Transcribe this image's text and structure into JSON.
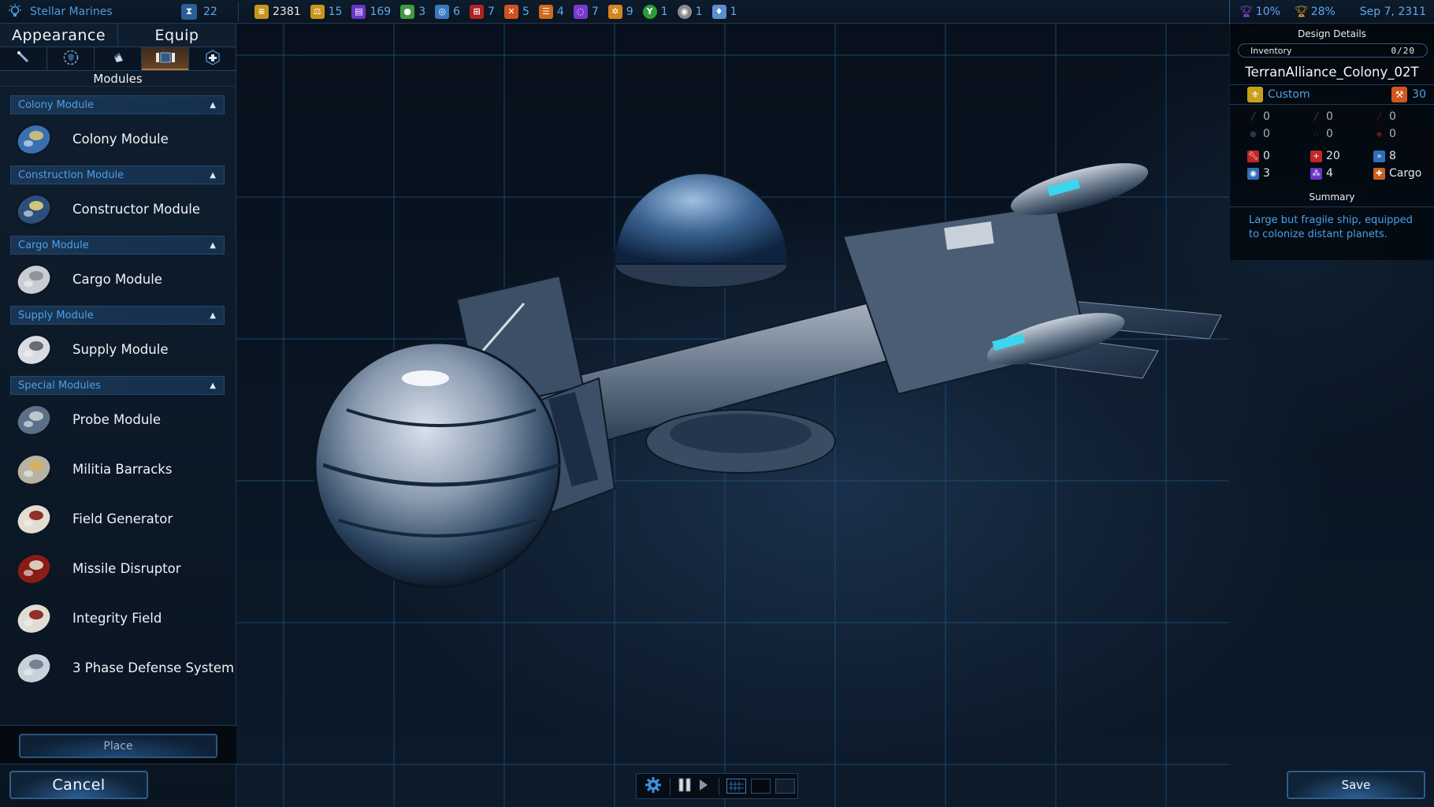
{
  "topbar": {
    "faction_name": "Stellar Marines",
    "turn_count": "22",
    "resources": [
      {
        "name": "credits",
        "icon": "credits-icon",
        "value": "2381",
        "color": "#c8951c"
      },
      {
        "name": "influence",
        "icon": "scales-icon",
        "value": "15",
        "color": "#c8951c"
      },
      {
        "name": "research",
        "icon": "research-icon",
        "value": "169",
        "color": "#6a35c6"
      },
      {
        "name": "food",
        "icon": "apple-icon",
        "value": "3",
        "color": "#3f9a3f"
      },
      {
        "name": "tech-resource",
        "icon": "ring-icon",
        "value": "6",
        "color": "#3a78c0"
      },
      {
        "name": "strategic-resource-1",
        "icon": "grid-icon",
        "value": "7",
        "color": "#b02222"
      },
      {
        "name": "strategic-resource-2",
        "icon": "cross-icon",
        "value": "5",
        "color": "#d0521e"
      },
      {
        "name": "strategic-resource-3",
        "icon": "stripes-icon",
        "value": "4",
        "color": "#d06a18"
      },
      {
        "name": "strategic-resource-4",
        "icon": "swirl-icon",
        "value": "7",
        "color": "#7a3ad0"
      },
      {
        "name": "strategic-resource-5",
        "icon": "gear-flower-icon",
        "value": "9",
        "color": "#d4861e"
      },
      {
        "name": "strategic-resource-6",
        "icon": "tree-icon",
        "value": "1",
        "color": "#2e9a3c"
      },
      {
        "name": "strategic-resource-7",
        "icon": "disc-icon",
        "value": "1",
        "color": "#8a8a8a"
      },
      {
        "name": "strategic-resource-8",
        "icon": "crystal-icon",
        "value": "1",
        "color": "#5d8ed0"
      }
    ],
    "score_purple": "10%",
    "score_gold": "28%",
    "date": "Sep 7, 2311"
  },
  "left_panel": {
    "tabs": [
      "Appearance",
      "Equip"
    ],
    "icon_tabs": [
      {
        "icon": "weapon-icon",
        "active": false
      },
      {
        "icon": "shield-icon",
        "active": false
      },
      {
        "icon": "armor-icon",
        "active": false
      },
      {
        "icon": "module-icon",
        "active": true
      },
      {
        "icon": "support-icon",
        "active": false
      }
    ],
    "category_title": "Modules",
    "sections": [
      {
        "title": "Colony Module",
        "items": [
          "Colony Module"
        ]
      },
      {
        "title": "Construction Module",
        "items": [
          "Constructor Module"
        ]
      },
      {
        "title": "Cargo Module",
        "items": [
          "Cargo Module"
        ]
      },
      {
        "title": "Supply Module",
        "items": [
          "Supply Module"
        ]
      },
      {
        "title": "Special Modules",
        "items": [
          "Probe Module",
          "Militia Barracks",
          "Field Generator",
          "Missile Disruptor",
          "Integrity Field",
          "3 Phase Defense System"
        ]
      }
    ],
    "place_label": "Place",
    "cancel_label": "Cancel"
  },
  "right_panel": {
    "title": "Design Details",
    "inventory_label": "Inventory",
    "inventory_count": "0/20",
    "design_name": "TerranAlliance_Colony_02T",
    "design_class": "Custom",
    "build_cost": "30",
    "stats": [
      {
        "icon": "beam-weapon-icon",
        "value": "0",
        "dim": true,
        "color": "#2a5a80"
      },
      {
        "icon": "kinetic-weapon-icon",
        "value": "0",
        "dim": true,
        "color": "#6a4a2a"
      },
      {
        "icon": "missile-weapon-icon",
        "value": "0",
        "dim": true,
        "color": "#6a1818"
      },
      {
        "icon": "shield-defense-icon",
        "value": "0",
        "dim": true,
        "color": "#1e3a56"
      },
      {
        "icon": "point-defense-icon",
        "value": "0",
        "dim": true,
        "color": "#5a3a20"
      },
      {
        "icon": "armor-defense-icon",
        "value": "0",
        "dim": true,
        "color": "#6a1818"
      },
      {
        "icon": "repair-icon",
        "value": "0",
        "dim": false,
        "color": "#c0262a"
      },
      {
        "icon": "hull-points-icon",
        "value": "20",
        "dim": false,
        "color": "#c0262a"
      },
      {
        "icon": "speed-icon",
        "value": "8",
        "dim": false,
        "color": "#2f6fb8"
      },
      {
        "icon": "sensor-icon",
        "value": "3",
        "dim": false,
        "color": "#2f6fb8"
      },
      {
        "icon": "crew-icon",
        "value": "4",
        "dim": false,
        "color": "#6a35c6"
      },
      {
        "icon": "cargo-icon",
        "value": "Cargo",
        "dim": false,
        "color": "#c9621a"
      }
    ],
    "summary_title": "Summary",
    "summary_text": "Large but fragile ship, equipped to colonize distant planets."
  },
  "toolbar": {
    "save_label": "Save"
  },
  "colors": {
    "accent_blue": "#4aa0ec",
    "active_tab": "#6a4526"
  }
}
